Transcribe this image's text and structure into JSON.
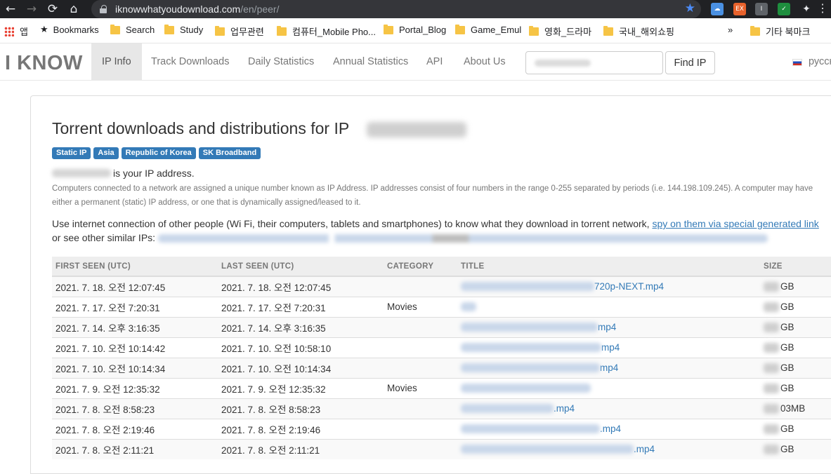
{
  "browser": {
    "url_domain": "iknowwhatyoudownload.com",
    "url_path": "/en/peer/",
    "back_icon": "←",
    "forward_icon": "→",
    "reload_icon": "⟳",
    "home_icon": "⌂",
    "bookmark_star": "★",
    "extensions": [
      "EX",
      "I"
    ],
    "menu_icon": "⋮"
  },
  "bookmarks": {
    "apps": "앱",
    "items": [
      "Bookmarks",
      "Search",
      "Study",
      "업무관련",
      "컴퓨터_Mobile Pho...",
      "Portal_Blog",
      "Game_Emul",
      "영화_드라마",
      "국내_해외쇼핑"
    ],
    "overflow": "»",
    "other": "기타 북마크"
  },
  "site": {
    "logo": "I KNOW",
    "nav": [
      "IP Info",
      "Track Downloads",
      "Daily Statistics",
      "Annual Statistics",
      "API",
      "About Us"
    ],
    "find_button": "Find IP",
    "language": "русский"
  },
  "page": {
    "heading": "Torrent downloads and distributions for IP",
    "badges": [
      "Static IP",
      "Asia",
      "Republic of Korea",
      "SK Broadband"
    ],
    "your_ip_suffix": "is your IP address.",
    "explanation": "Computers connected to a network are assigned a unique number known as IP Address. IP addresses consist of four numbers in the range 0-255 separated by periods (i.e. 144.198.109.245). A computer may have either a permanent (static) IP address, or one that is dynamically assigned/leased to it.",
    "use_text": "Use internet connection of other people (Wi Fi, their computers, tablets and smartphones) to know what they download in torrent network,",
    "spy_link": "spy on them via special generated link",
    "similar_text": "or see other similar IPs:"
  },
  "table": {
    "headers": [
      "FIRST SEEN (UTC)",
      "LAST SEEN (UTC)",
      "CATEGORY",
      "TITLE",
      "SIZE"
    ],
    "rows": [
      {
        "first": "2021. 7. 18. 오전 12:07:45",
        "last": "2021. 7. 18. 오전 12:07:45",
        "category": "",
        "title_suffix": "720p-NEXT.mp4",
        "size_suffix": "GB"
      },
      {
        "first": "2021. 7. 17. 오전 7:20:31",
        "last": "2021. 7. 17. 오전 7:20:31",
        "category": "Movies",
        "title_suffix": "",
        "size_suffix": "GB"
      },
      {
        "first": "2021. 7. 14. 오후 3:16:35",
        "last": "2021. 7. 14. 오후 3:16:35",
        "category": "",
        "title_suffix": "mp4",
        "size_suffix": "GB"
      },
      {
        "first": "2021. 7. 10. 오전 10:14:42",
        "last": "2021. 7. 10. 오전 10:58:10",
        "category": "",
        "title_suffix": "mp4",
        "size_suffix": "GB"
      },
      {
        "first": "2021. 7. 10. 오전 10:14:34",
        "last": "2021. 7. 10. 오전 10:14:34",
        "category": "",
        "title_suffix": "mp4",
        "size_suffix": "GB"
      },
      {
        "first": "2021. 7. 9. 오전 12:35:32",
        "last": "2021. 7. 9. 오전 12:35:32",
        "category": "Movies",
        "title_suffix": "",
        "size_suffix": "GB"
      },
      {
        "first": "2021. 7. 8. 오전 8:58:23",
        "last": "2021. 7. 8. 오전 8:58:23",
        "category": "",
        "title_suffix": ".mp4",
        "size_suffix": "03MB"
      },
      {
        "first": "2021. 7. 8. 오전 2:19:46",
        "last": "2021. 7. 8. 오전 2:19:46",
        "category": "",
        "title_suffix": ".mp4",
        "size_suffix": "GB"
      },
      {
        "first": "2021. 7. 8. 오전 2:11:21",
        "last": "2021. 7. 8. 오전 2:11:21",
        "category": "",
        "title_suffix": ".mp4",
        "size_suffix": "GB"
      }
    ]
  }
}
